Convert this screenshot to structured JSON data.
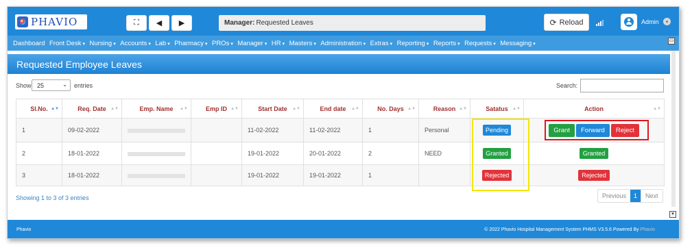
{
  "app": {
    "logo_text": "PHAVIO",
    "breadcrumb_section": "Manager:",
    "breadcrumb_page": "Requested Leaves",
    "reload_label": "Reload",
    "user_name": "Admin"
  },
  "nav": {
    "items": [
      "Dashboard",
      "Front Desk",
      "Nursing",
      "Accounts",
      "Lab",
      "Pharmacy",
      "PROs",
      "Manager",
      "HR",
      "Masters",
      "Administration",
      "Extras",
      "Reporting",
      "Reports",
      "Requests",
      "Messaging"
    ],
    "caret": "▾"
  },
  "page": {
    "title": "Requested Employee Leaves",
    "show_label": "Show",
    "entries_value": "25",
    "entries_label": "entries",
    "search_label": "Search:",
    "search_value": ""
  },
  "table": {
    "headers": [
      "Sl.No.",
      "Req. Date",
      "Emp. Name",
      "Emp ID",
      "Start Date",
      "End date",
      "No. Days",
      "Reason",
      "Satatus",
      "Action"
    ],
    "rows": [
      {
        "sl": "1",
        "req_date": "09-02-2022",
        "emp_id": "",
        "start": "11-02-2022",
        "end": "11-02-2022",
        "days": "1",
        "reason": "Personal",
        "status": "Pending",
        "actions": [
          "Grant",
          "Forward",
          "Reject"
        ]
      },
      {
        "sl": "2",
        "req_date": "18-01-2022",
        "emp_id": "",
        "start": "19-01-2022",
        "end": "20-01-2022",
        "days": "2",
        "reason": "NEED",
        "status": "Granted",
        "action_state": "Granted"
      },
      {
        "sl": "3",
        "req_date": "18-01-2022",
        "emp_id": "",
        "start": "19-01-2022",
        "end": "19-01-2022",
        "days": "1",
        "reason": "",
        "status": "Rejected",
        "action_state": "Rejected"
      }
    ]
  },
  "pagination": {
    "summary": "Showing 1 to 3 of 3 entries",
    "previous": "Previous",
    "current": "1",
    "next": "Next"
  },
  "footer": {
    "left": "Phavio",
    "right": "© 2022 Phavio Hospital Management System PHMS V3.5.6 Powered By",
    "brand": "Phavio"
  },
  "colors": {
    "primary": "#1f88d8",
    "nav": "#3f9be0",
    "green": "#23a041",
    "red": "#e2323a",
    "highlight_yellow": "#f4e600",
    "highlight_red": "#e0151d"
  },
  "icons": {
    "fullscreen": "expand-icon",
    "back": "arrow-left-icon",
    "forward": "arrow-right-icon",
    "reload": "refresh-icon",
    "signal": "signal-icon",
    "user": "user-icon"
  }
}
